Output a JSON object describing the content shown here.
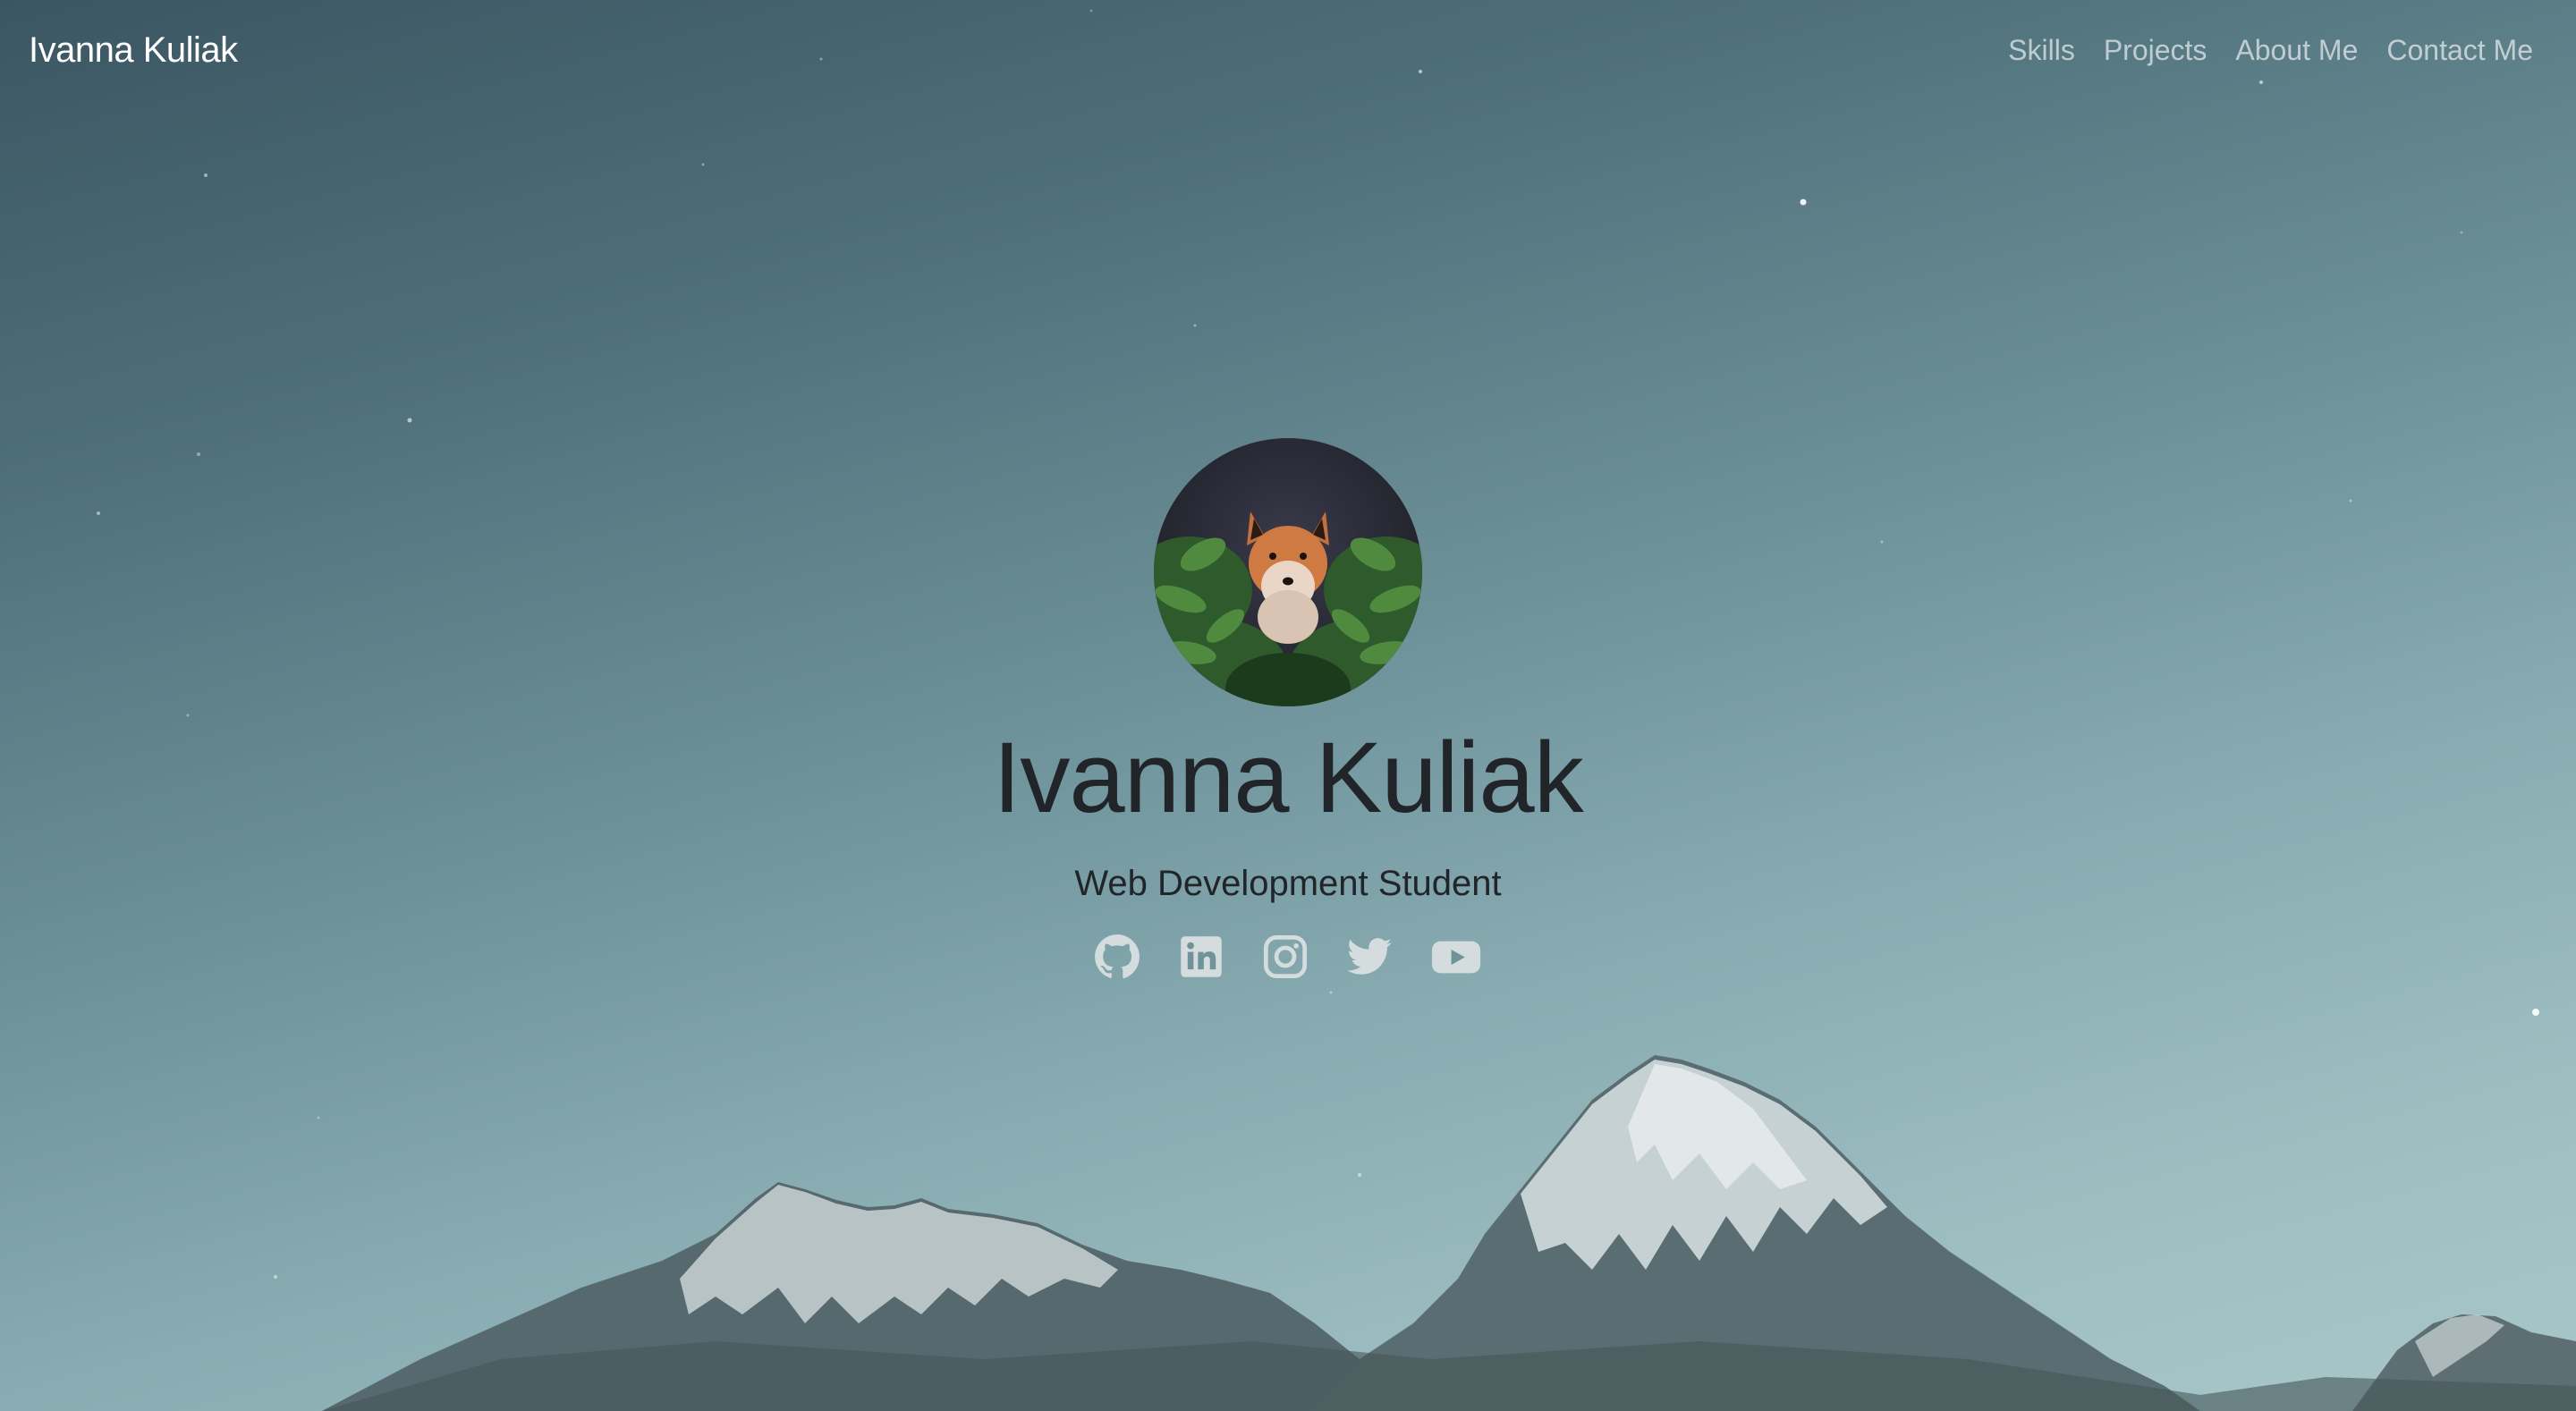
{
  "navbar": {
    "brand": "Ivanna Kuliak",
    "links": [
      {
        "label": "Skills"
      },
      {
        "label": "Projects"
      },
      {
        "label": "About Me"
      },
      {
        "label": "Contact Me"
      }
    ]
  },
  "hero": {
    "name": "Ivanna Kuliak",
    "subtitle": "Web Development Student",
    "avatar_icon": "fox-photo",
    "social": [
      {
        "icon": "github-icon"
      },
      {
        "icon": "linkedin-icon"
      },
      {
        "icon": "instagram-icon"
      },
      {
        "icon": "twitter-icon"
      },
      {
        "icon": "youtube-icon"
      }
    ]
  },
  "colors": {
    "text_dark": "#212529",
    "nav_link": "rgba(255,255,255,0.62)",
    "icon": "#d4dcde"
  }
}
